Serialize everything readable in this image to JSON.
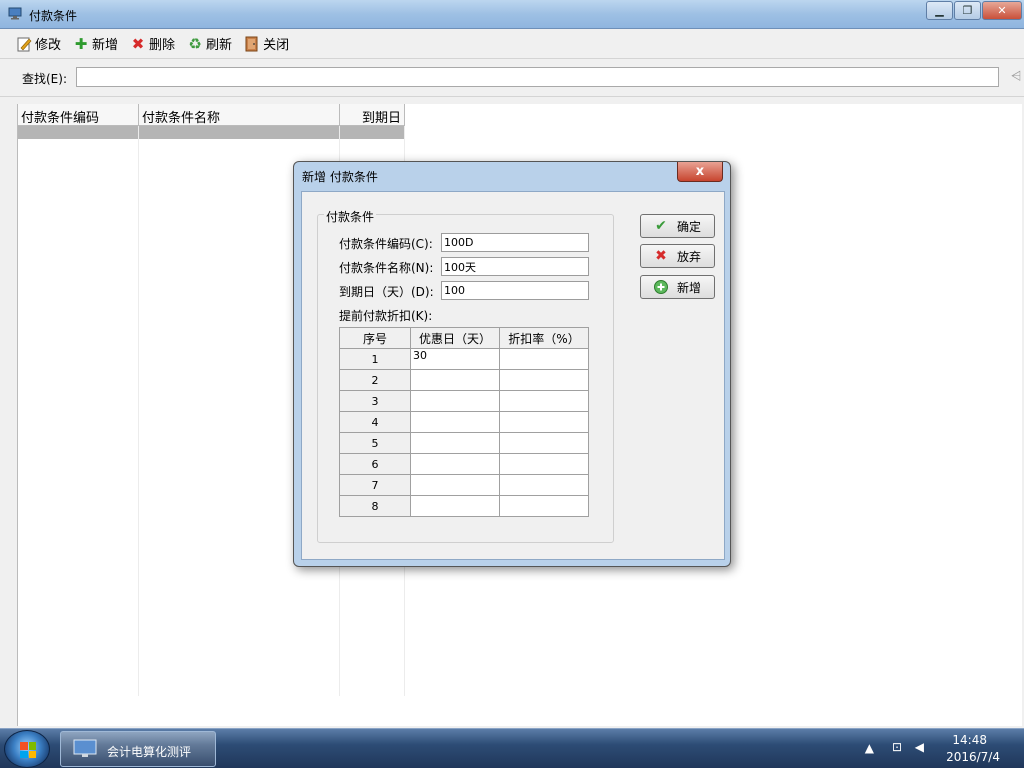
{
  "window": {
    "title": "付款条件"
  },
  "toolbar": {
    "edit_label": "修改",
    "add_label": "新增",
    "delete_label": "删除",
    "refresh_label": "刷新",
    "close_label": "关闭"
  },
  "search": {
    "label": "查找(E):",
    "value": ""
  },
  "grid": {
    "columns": [
      "付款条件编码",
      "付款条件名称",
      "到期日"
    ]
  },
  "dialog": {
    "title": "新增 付款条件",
    "group_title": "付款条件",
    "code_label": "付款条件编码(C):",
    "code_value": "100D",
    "name_label": "付款条件名称(N):",
    "name_value": "100天",
    "due_label": "到期日（天）(D):",
    "due_value": "100",
    "discount_label": "提前付款折扣(K):",
    "table_headers": [
      "序号",
      "优惠日（天）",
      "折扣率（%）"
    ],
    "rows": [
      {
        "no": "1",
        "days": "30",
        "rate": ""
      },
      {
        "no": "2",
        "days": "",
        "rate": ""
      },
      {
        "no": "3",
        "days": "",
        "rate": ""
      },
      {
        "no": "4",
        "days": "",
        "rate": ""
      },
      {
        "no": "5",
        "days": "",
        "rate": ""
      },
      {
        "no": "6",
        "days": "",
        "rate": ""
      },
      {
        "no": "7",
        "days": "",
        "rate": ""
      },
      {
        "no": "8",
        "days": "",
        "rate": ""
      }
    ],
    "ok_label": "确定",
    "cancel_label": "放弃",
    "new_label": "新增",
    "close_glyph": "x"
  },
  "taskbar": {
    "app_label": "会计电算化测评",
    "time": "14:48",
    "date": "2016/7/4"
  },
  "colors": {
    "title_bar": "#9ec0e4",
    "dialog_frame": "#b9d1ea",
    "selection": "#b5b5b5",
    "taskbar": "#2d4c75"
  }
}
